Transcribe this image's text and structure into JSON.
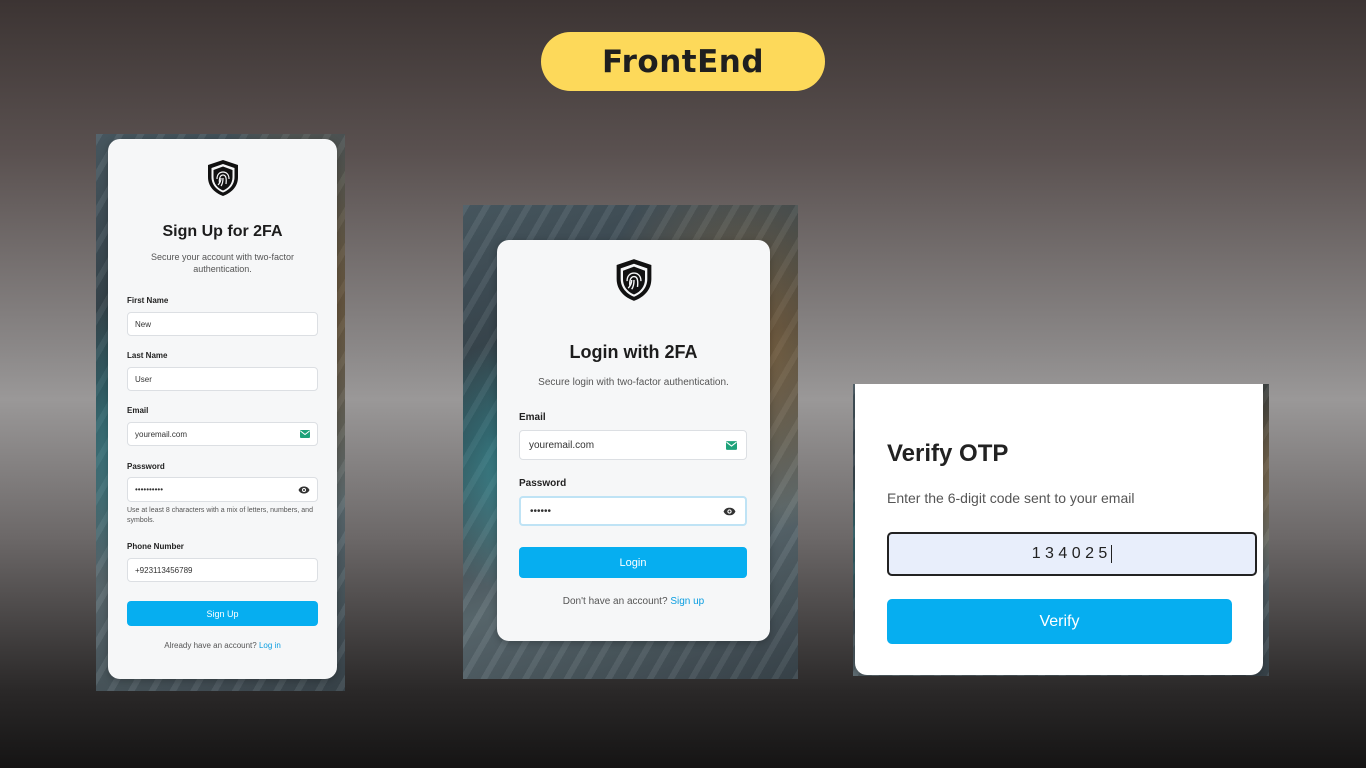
{
  "banner": {
    "title": "FrontEnd"
  },
  "signup": {
    "title": "Sign Up for 2FA",
    "subtitle": "Secure your account with two-factor authentication.",
    "first_name_label": "First Name",
    "first_name_value": "New",
    "last_name_label": "Last Name",
    "last_name_value": "User",
    "email_label": "Email",
    "email_value": "youremail.com",
    "password_label": "Password",
    "password_value": "••••••••••",
    "password_hint": "Use at least 8 characters with a mix of letters, numbers, and symbols.",
    "phone_label": "Phone Number",
    "phone_value": "+923113456789",
    "button": "Sign Up",
    "footer_text": "Already have an account?",
    "footer_link": "Log in"
  },
  "login": {
    "title": "Login with 2FA",
    "subtitle": "Secure login with two-factor authentication.",
    "email_label": "Email",
    "email_value": "youremail.com",
    "password_label": "Password",
    "password_value": "••••••",
    "button": "Login",
    "footer_text": "Don't have an account?",
    "footer_link": "Sign up"
  },
  "otp": {
    "title": "Verify OTP",
    "subtitle": "Enter the 6-digit code sent to your email",
    "code": "1 3 4 0 2 5",
    "button": "Verify"
  },
  "colors": {
    "accent": "#06aef0",
    "banner": "#fdd95a",
    "otp_field": "#e8eefb"
  },
  "icons": [
    "shield-fingerprint-icon",
    "mail-icon",
    "eye-icon"
  ]
}
